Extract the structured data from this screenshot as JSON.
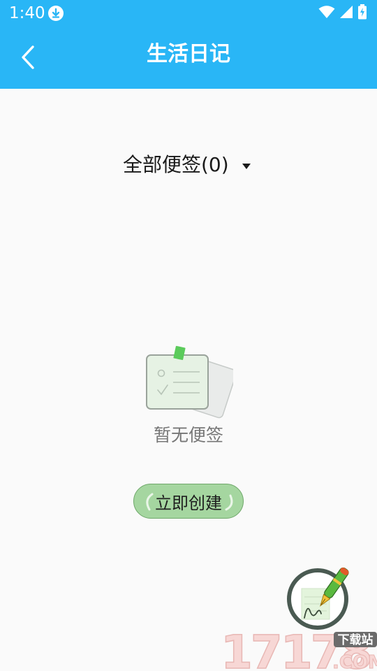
{
  "status_bar": {
    "time": "1:40",
    "icons": [
      "download-icon",
      "wifi-icon",
      "cell-signal-icon",
      "battery-charging-icon"
    ]
  },
  "app_bar": {
    "title": "生活日记",
    "back_icon": "chevron-left-icon"
  },
  "filter": {
    "label": "全部便签(0)",
    "dropdown_icon": "triangle-down-icon"
  },
  "empty_state": {
    "text": "暂无便签",
    "illustration": "note-cards-icon"
  },
  "actions": {
    "create_label": "立即创建",
    "fab_icon": "fountain-pen-icon"
  },
  "watermark": {
    "logo_text": "17178",
    "domain_text": ".COM",
    "tag_text": "下载站"
  },
  "colors": {
    "header_bg": "#29b6f6",
    "page_bg": "#fafafa",
    "create_button_bg": "#a5d6a0",
    "fab_ring": "#4a5a52"
  }
}
